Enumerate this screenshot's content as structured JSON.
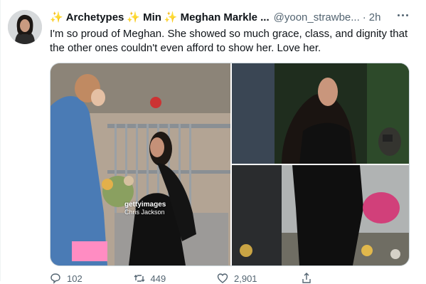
{
  "tweet": {
    "display_name_parts": [
      "Archetypes",
      "Min",
      "Meghan Markle ..."
    ],
    "handle": "@yoon_strawbe...",
    "separator": "·",
    "time": "2h",
    "text": "I'm so proud of Meghan. She showed so much grace, class, and dignity that the other ones couldn't even afford to show her. Love her.",
    "media_watermark": {
      "brand": "gettyimages",
      "credit": "Chris Jackson"
    },
    "actions": {
      "reply_count": "102",
      "retweet_count": "449",
      "like_count": "2,901"
    }
  },
  "icons": {
    "sparkle": "sparkles-emoji",
    "more": "more-dots-icon"
  },
  "colors": {
    "text_primary": "#0f1419",
    "text_secondary": "#536471",
    "sparkle": "#f4b400",
    "border": "#cfd9de"
  }
}
